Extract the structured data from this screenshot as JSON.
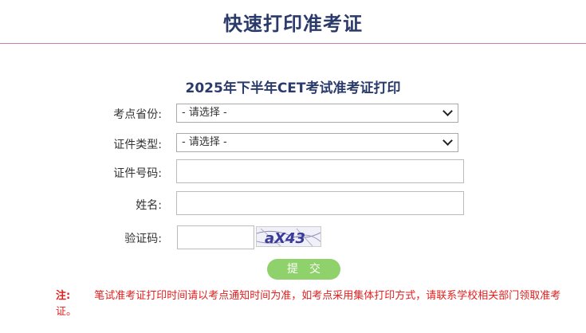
{
  "page_title": "快速打印准考证",
  "form_title": "2025年下半年CET考试准考证打印",
  "fields": {
    "province": {
      "label": "考点省份:",
      "value": "- 请选择 -"
    },
    "cert_type": {
      "label": "证件类型:",
      "value": "- 请选择 -"
    },
    "cert_number": {
      "label": "证件号码:",
      "value": ""
    },
    "name": {
      "label": "姓名:",
      "value": ""
    },
    "captcha": {
      "label": "验证码:",
      "value": "",
      "image_text": "aX43"
    }
  },
  "submit_label": "提交",
  "note": {
    "tag": "注:",
    "text": "笔试准考证打印时间请以考点通知时间为准，如考点采用集体打印方式，请联系学校相关部门领取准考证。"
  },
  "colors": {
    "title": "#2a3a6b",
    "rule": "#c77db0",
    "submit": "#8fd16a",
    "note": "#e02020"
  }
}
